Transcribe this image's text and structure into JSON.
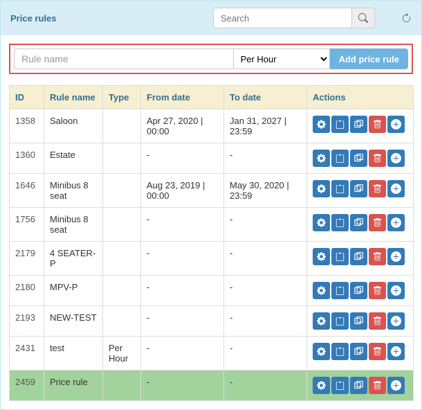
{
  "header": {
    "title": "Price rules",
    "search_placeholder": "Search"
  },
  "addRow": {
    "rule_name_placeholder": "Rule name",
    "selected_type": "Per Hour",
    "add_button": "Add price rule"
  },
  "columns": {
    "id": "ID",
    "rule_name": "Rule name",
    "type": "Type",
    "from_date": "From date",
    "to_date": "To date",
    "actions": "Actions"
  },
  "rows": [
    {
      "id": "1358",
      "rule_name": "Saloon",
      "type": "",
      "from": "Apr 27, 2020 | 00:00",
      "to": "Jan 31, 2027 | 23:59",
      "highlight": false
    },
    {
      "id": "1360",
      "rule_name": "Estate",
      "type": "",
      "from": "-",
      "to": "-",
      "highlight": false
    },
    {
      "id": "1646",
      "rule_name": "Minibus 8 seat",
      "type": "",
      "from": "Aug 23, 2019 | 00:00",
      "to": "May 30, 2020 | 23:59",
      "highlight": false
    },
    {
      "id": "1756",
      "rule_name": "Minibus 8 seat",
      "type": "",
      "from": "-",
      "to": "-",
      "highlight": false
    },
    {
      "id": "2179",
      "rule_name": "4 SEATER-P",
      "type": "",
      "from": "-",
      "to": "-",
      "highlight": false
    },
    {
      "id": "2180",
      "rule_name": "MPV-P",
      "type": "",
      "from": "-",
      "to": "-",
      "highlight": false
    },
    {
      "id": "2193",
      "rule_name": "NEW-TEST",
      "type": "",
      "from": "-",
      "to": "-",
      "highlight": false
    },
    {
      "id": "2431",
      "rule_name": "test",
      "type": "Per Hour",
      "from": "-",
      "to": "-",
      "highlight": false
    },
    {
      "id": "2459",
      "rule_name": "Price rule",
      "type": "",
      "from": "-",
      "to": "-",
      "highlight": true
    }
  ]
}
